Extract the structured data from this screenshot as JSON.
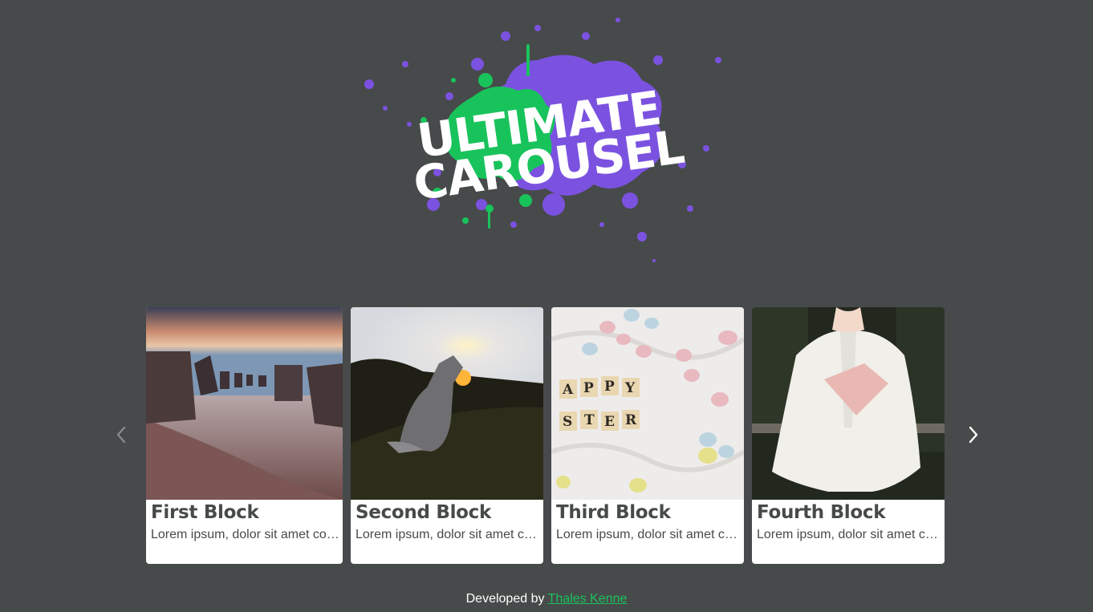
{
  "logo": {
    "line1": "ULTIMATE",
    "line2": "CAROUSEL",
    "colors": {
      "purple": "#7b52e0",
      "green": "#19c35c"
    }
  },
  "carousel": {
    "prev_icon": "chevron-left-icon",
    "next_icon": "chevron-right-icon",
    "cards": [
      {
        "title": "First Block",
        "text": "Lorem ipsum, dolor sit amet consectetur adipisicing elit."
      },
      {
        "title": "Second Block",
        "text": "Lorem ipsum, dolor sit amet consectetur adipisicing elit."
      },
      {
        "title": "Third Block",
        "text": "Lorem ipsum, dolor sit amet consectetur adipisicing elit."
      },
      {
        "title": "Fourth Block",
        "text": "Lorem ipsum, dolor sit amet consectetur adipisicing elit."
      }
    ]
  },
  "footer": {
    "prefix": "Developed by",
    "author": "Thales Kenne"
  },
  "colors": {
    "background": "#474a4a",
    "card": "#ffffff",
    "text": "#474a4a",
    "link": "#19c35c"
  }
}
